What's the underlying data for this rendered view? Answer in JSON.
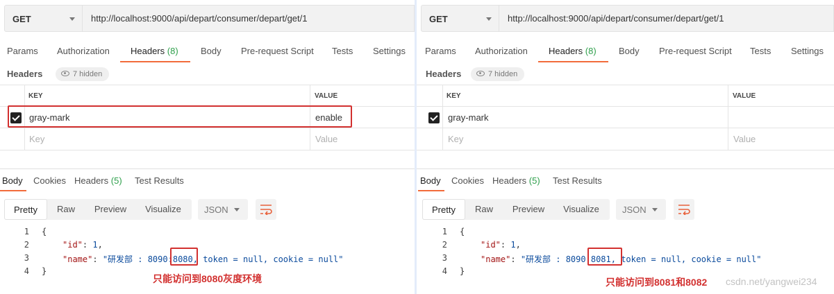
{
  "left": {
    "method": "GET",
    "url": "http://localhost:9000/api/depart/consumer/depart/get/1",
    "tabs": [
      {
        "label": "Params"
      },
      {
        "label": "Authorization"
      },
      {
        "label": "Headers",
        "count": "(8)"
      },
      {
        "label": "Body"
      },
      {
        "label": "Pre-request Script"
      },
      {
        "label": "Tests"
      },
      {
        "label": "Settings"
      }
    ],
    "headers_label": "Headers",
    "hidden_label": "7 hidden",
    "col_key": "KEY",
    "col_value": "VALUE",
    "row_key": "gray-mark",
    "row_value": "enable",
    "key_placeholder": "Key",
    "value_placeholder": "Value",
    "resp_tabs": [
      {
        "label": "Body"
      },
      {
        "label": "Cookies"
      },
      {
        "label": "Headers",
        "count": "(5)"
      },
      {
        "label": "Test Results"
      }
    ],
    "views": [
      "Pretty",
      "Raw",
      "Preview",
      "Visualize"
    ],
    "format": "JSON",
    "code": {
      "line_numbers": [
        "1",
        "2",
        "3",
        "4"
      ],
      "open": "{",
      "id_key": "\"id\"",
      "id_val": "1",
      "name_key": "\"name\"",
      "name_prefix": "\"研发部 : 8090:",
      "name_port": "8080",
      "name_suffix": ", token = null, cookie = null\"",
      "close": "}"
    },
    "note": "只能访问到8080灰度环境"
  },
  "right": {
    "method": "GET",
    "url": "http://localhost:9000/api/depart/consumer/depart/get/1",
    "tabs": [
      {
        "label": "Params"
      },
      {
        "label": "Authorization"
      },
      {
        "label": "Headers",
        "count": "(8)"
      },
      {
        "label": "Body"
      },
      {
        "label": "Pre-request Script"
      },
      {
        "label": "Tests"
      },
      {
        "label": "Settings"
      }
    ],
    "headers_label": "Headers",
    "hidden_label": "7 hidden",
    "col_key": "KEY",
    "col_value": "VALUE",
    "row_key": "gray-mark",
    "row_value": "",
    "key_placeholder": "Key",
    "value_placeholder": "Value",
    "resp_tabs": [
      {
        "label": "Body"
      },
      {
        "label": "Cookies"
      },
      {
        "label": "Headers",
        "count": "(5)"
      },
      {
        "label": "Test Results"
      }
    ],
    "views": [
      "Pretty",
      "Raw",
      "Preview",
      "Visualize"
    ],
    "format": "JSON",
    "code": {
      "line_numbers": [
        "1",
        "2",
        "3",
        "4"
      ],
      "open": "{",
      "id_key": "\"id\"",
      "id_val": "1",
      "name_key": "\"name\"",
      "name_prefix": "\"研发部 : 8090 ",
      "name_port": "8081,",
      "name_suffix": " token = null, cookie = null\"",
      "close": "}"
    },
    "note": "只能访问到8081和8082",
    "watermark": "csdn.net/yangwei234"
  },
  "colors": {
    "accent": "#f26b3a",
    "count_green": "#2e9f4b",
    "annotation_red": "#d2302f"
  }
}
